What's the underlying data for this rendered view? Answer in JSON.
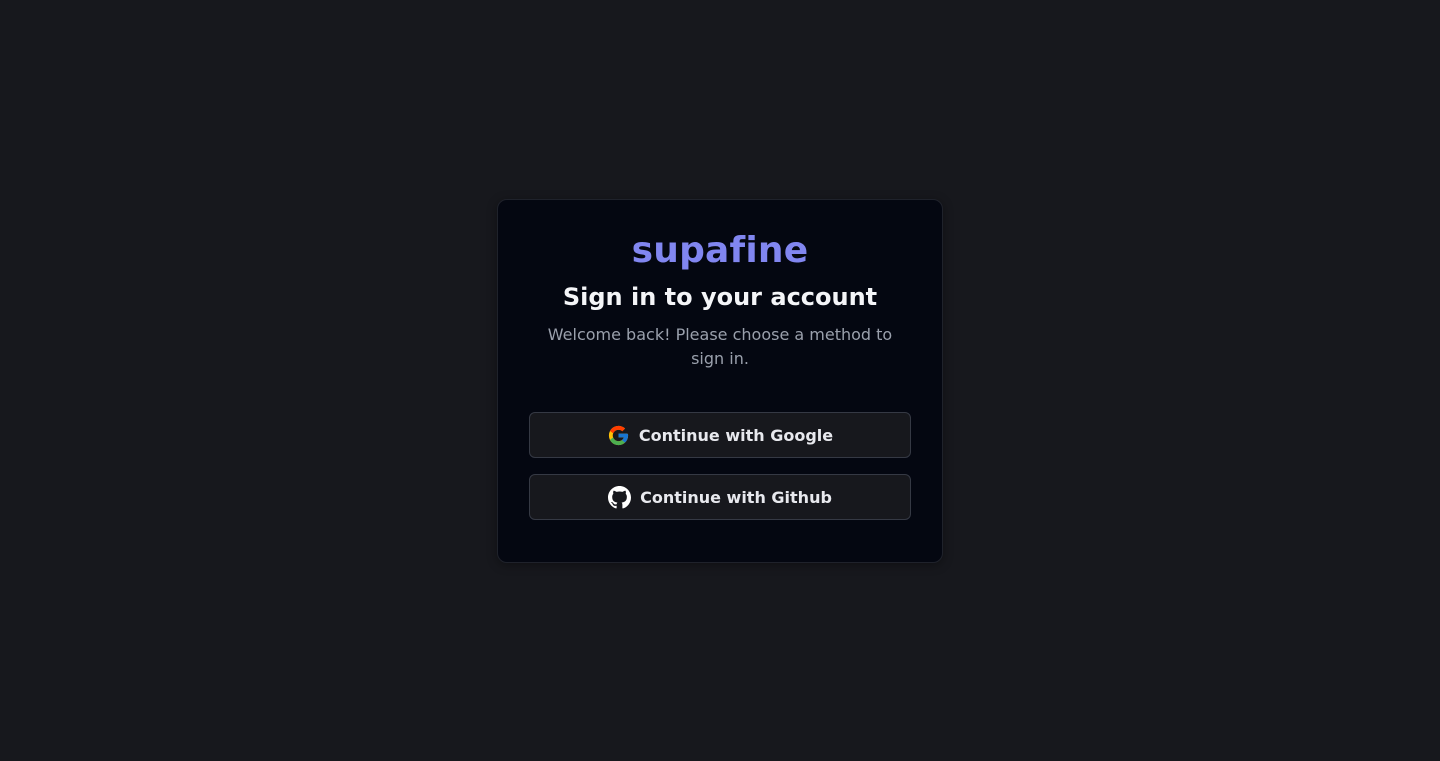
{
  "brand": "supafine",
  "heading": "Sign in to your account",
  "subtitle": "Welcome back! Please choose a method to sign in.",
  "buttons": {
    "google": {
      "label": "Continue with Google",
      "icon": "google-icon"
    },
    "github": {
      "label": "Continue with Github",
      "icon": "github-icon"
    }
  },
  "colors": {
    "background": "#17181d",
    "card": "#040711",
    "brand": "#8186f0",
    "button_border": "#353944"
  }
}
